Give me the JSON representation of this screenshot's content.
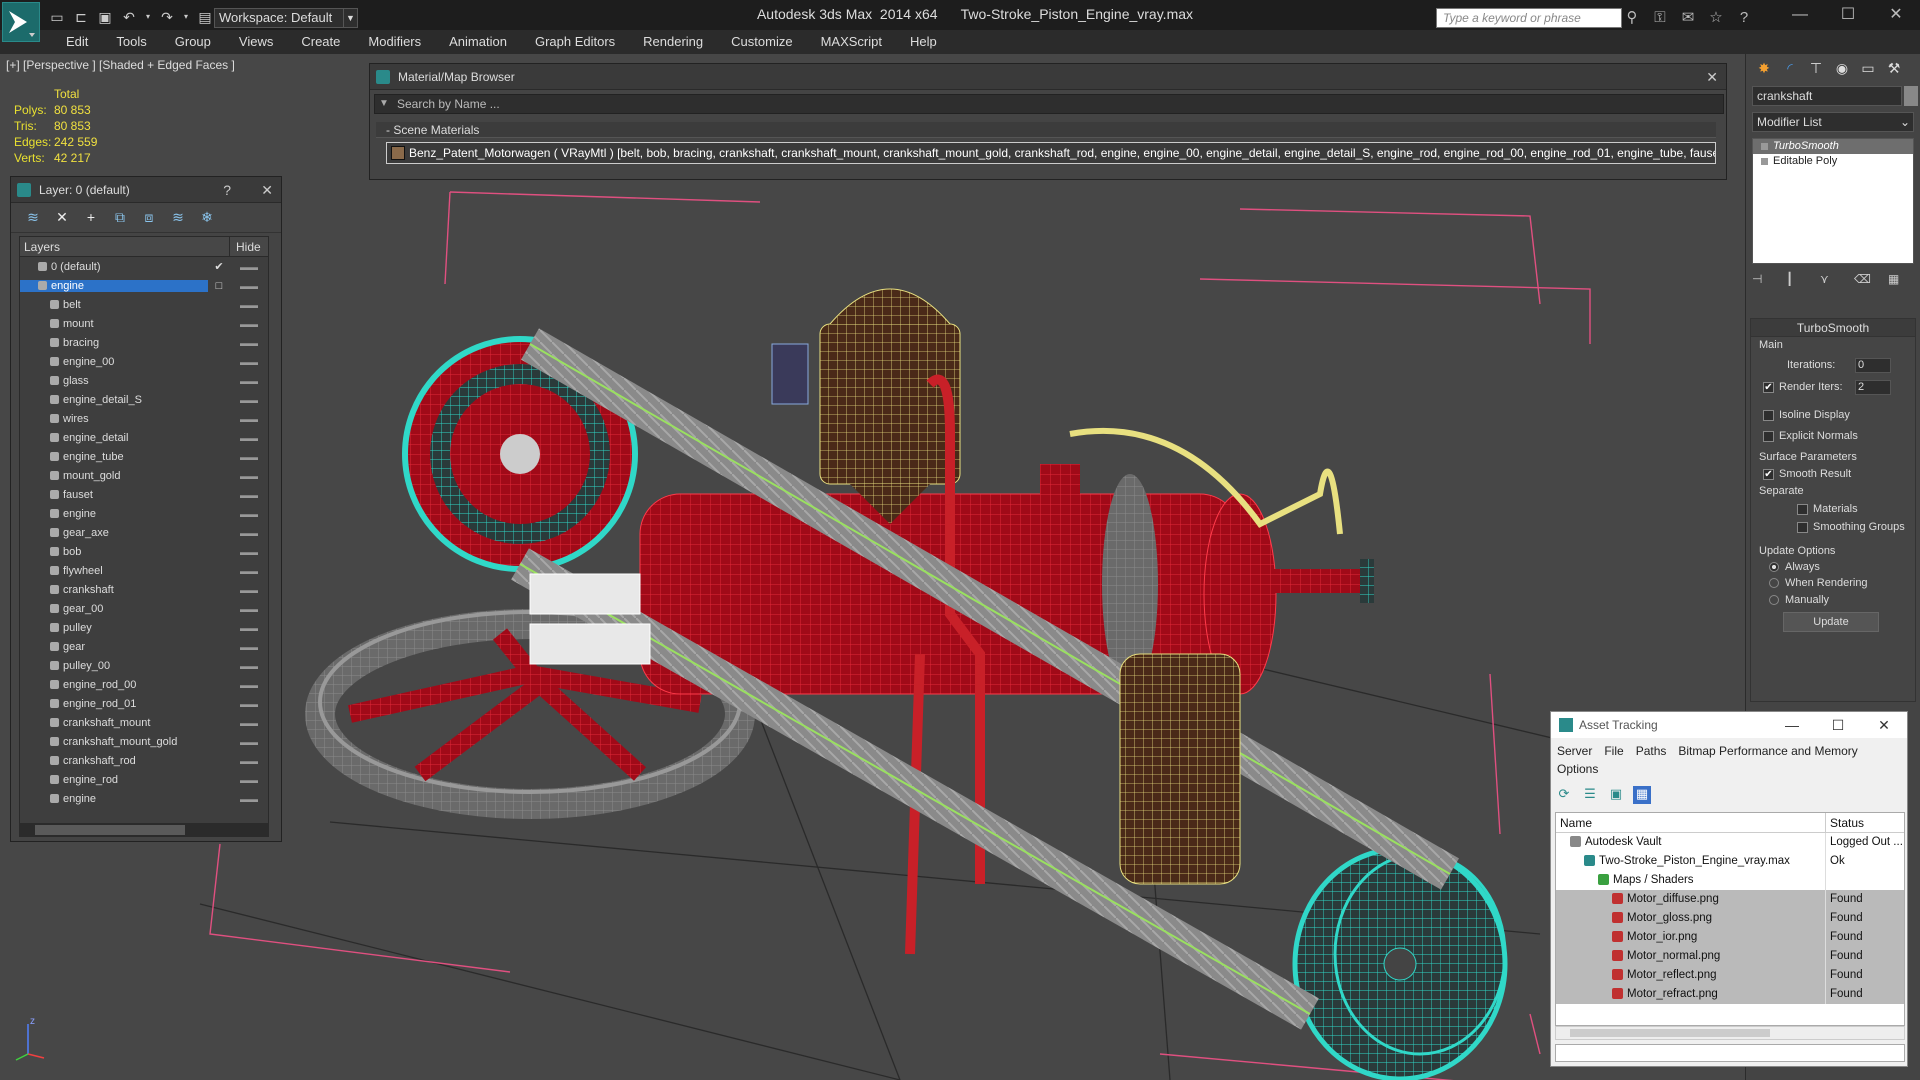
{
  "app": {
    "title": "Autodesk 3ds Max  2014 x64      Two-Stroke_Piston_Engine_vray.max",
    "workspace": "Workspace: Default",
    "search_placeholder": "Type a keyword or phrase"
  },
  "menu": [
    "Edit",
    "Tools",
    "Group",
    "Views",
    "Create",
    "Modifiers",
    "Animation",
    "Graph Editors",
    "Rendering",
    "Customize",
    "MAXScript",
    "Help"
  ],
  "viewport": {
    "label": "[+] [Perspective ] [Shaded + Edged Faces ]",
    "stats_header": "Total",
    "stats": [
      {
        "label": "Polys:",
        "value": "80 853"
      },
      {
        "label": "Tris:",
        "value": "80 853"
      },
      {
        "label": "Edges:",
        "value": "242 559"
      },
      {
        "label": "Verts:",
        "value": "42 217"
      }
    ],
    "axis_z": "z",
    "axis_x": "x"
  },
  "material_browser": {
    "title": "Material/Map Browser",
    "search_placeholder": "Search by Name ...",
    "section": "Scene Materials",
    "row": "Benz_Patent_Motorwagen ( VRayMtl ) [belt, bob, bracing, crankshaft, crankshaft_mount, crankshaft_mount_gold, crankshaft_rod, engine, engine_00, engine_detail, engine_detail_S, engine_rod, engine_rod_00, engine_rod_01, engine_tube, fauset, flywhe..."
  },
  "layer_panel": {
    "title": "Layer: 0 (default)",
    "help": "?",
    "col_layers": "Layers",
    "col_hide": "Hide",
    "items": [
      {
        "name": "0 (default)",
        "level": 1,
        "state": "✔"
      },
      {
        "name": "engine",
        "level": 1,
        "state": "□",
        "selected": true
      },
      {
        "name": "belt",
        "level": 2
      },
      {
        "name": "mount",
        "level": 2
      },
      {
        "name": "bracing",
        "level": 2
      },
      {
        "name": "engine_00",
        "level": 2
      },
      {
        "name": "glass",
        "level": 2
      },
      {
        "name": "engine_detail_S",
        "level": 2
      },
      {
        "name": "wires",
        "level": 2
      },
      {
        "name": "engine_detail",
        "level": 2
      },
      {
        "name": "engine_tube",
        "level": 2
      },
      {
        "name": "mount_gold",
        "level": 2
      },
      {
        "name": "fauset",
        "level": 2
      },
      {
        "name": "engine",
        "level": 2
      },
      {
        "name": "gear_axe",
        "level": 2
      },
      {
        "name": "bob",
        "level": 2
      },
      {
        "name": "flywheel",
        "level": 2
      },
      {
        "name": "crankshaft",
        "level": 2
      },
      {
        "name": "gear_00",
        "level": 2
      },
      {
        "name": "pulley",
        "level": 2
      },
      {
        "name": "gear",
        "level": 2
      },
      {
        "name": "pulley_00",
        "level": 2
      },
      {
        "name": "engine_rod_00",
        "level": 2
      },
      {
        "name": "engine_rod_01",
        "level": 2
      },
      {
        "name": "crankshaft_mount",
        "level": 2
      },
      {
        "name": "crankshaft_mount_gold",
        "level": 2
      },
      {
        "name": "crankshaft_rod",
        "level": 2
      },
      {
        "name": "engine_rod",
        "level": 2
      },
      {
        "name": "engine",
        "level": 2
      }
    ]
  },
  "command_panel": {
    "object_name": "crankshaft",
    "modifier_list": "Modifier List",
    "stack": [
      "TurboSmooth",
      "Editable Poly"
    ],
    "rollout_title": "TurboSmooth",
    "main": "Main",
    "iterations_label": "Iterations:",
    "iterations_value": "0",
    "render_iters_label": "Render Iters:",
    "render_iters_value": "2",
    "isoline": "Isoline Display",
    "explicit": "Explicit Normals",
    "surface": "Surface Parameters",
    "smooth_result": "Smooth Result",
    "separate": "Separate",
    "materials": "Materials",
    "smoothing_groups": "Smoothing Groups",
    "update_options": "Update Options",
    "always": "Always",
    "when_rendering": "When Rendering",
    "manually": "Manually",
    "update": "Update"
  },
  "asset_tracking": {
    "title": "Asset Tracking",
    "menu": [
      "Server",
      "File",
      "Paths",
      "Bitmap Performance and Memory"
    ],
    "menu2": "Options",
    "col_name": "Name",
    "col_status": "Status",
    "rows": [
      {
        "name": "Autodesk Vault",
        "status": "Logged Out ...",
        "indent": 1,
        "icon": "vault"
      },
      {
        "name": "Two-Stroke_Piston_Engine_vray.max",
        "status": "Ok",
        "indent": 2,
        "icon": "max"
      },
      {
        "name": "Maps / Shaders",
        "status": "",
        "indent": 3,
        "icon": "folder"
      },
      {
        "name": "Motor_diffuse.png",
        "status": "Found",
        "indent": 4,
        "icon": "png"
      },
      {
        "name": "Motor_gloss.png",
        "status": "Found",
        "indent": 4,
        "icon": "png"
      },
      {
        "name": "Motor_ior.png",
        "status": "Found",
        "indent": 4,
        "icon": "png"
      },
      {
        "name": "Motor_normal.png",
        "status": "Found",
        "indent": 4,
        "icon": "png"
      },
      {
        "name": "Motor_reflect.png",
        "status": "Found",
        "indent": 4,
        "icon": "png"
      },
      {
        "name": "Motor_refract.png",
        "status": "Found",
        "indent": 4,
        "icon": "png"
      }
    ]
  },
  "colors": {
    "accent": "#2c72c8",
    "stats": "#e8e030",
    "wire_teal": "#30c8b8",
    "engine_red": "#c01020"
  }
}
